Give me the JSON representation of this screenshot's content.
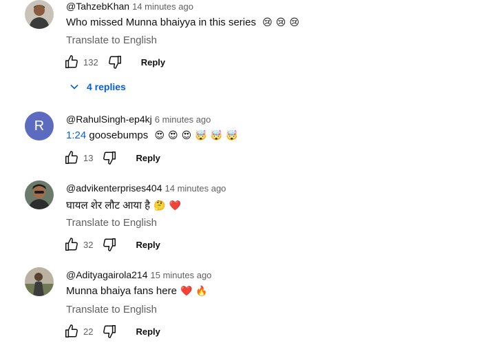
{
  "translate_label": "Translate to English",
  "reply_label": "Reply",
  "comments": [
    {
      "author": "@TahzebKhan",
      "time": "14 minutes ago",
      "text": "Who missed Munna bhaiyya in this series",
      "emojis": [
        "😢",
        "😢",
        "😢"
      ],
      "likes": "132",
      "replies_label": "4 replies"
    },
    {
      "author": "@RahulSingh-ep4kj",
      "time": "6 minutes ago",
      "avatar_letter": "R",
      "timestamp_link": "1:24",
      "text": " goosebumps",
      "emojis": [
        "😍",
        "😍",
        "😍",
        "🤯",
        "🤯",
        "🤯"
      ],
      "likes": "13"
    },
    {
      "author": "@advikenterprises404",
      "time": "14 minutes ago",
      "text": "घायल शेर लौट आया है",
      "emojis": [
        "🤔",
        "❤️"
      ],
      "likes": "32"
    },
    {
      "author": "@Adityagairola214",
      "time": "15 minutes ago",
      "text": "Munna bhaiya fans here",
      "emojis": [
        "❤️",
        "🔥"
      ],
      "likes": "22"
    }
  ]
}
